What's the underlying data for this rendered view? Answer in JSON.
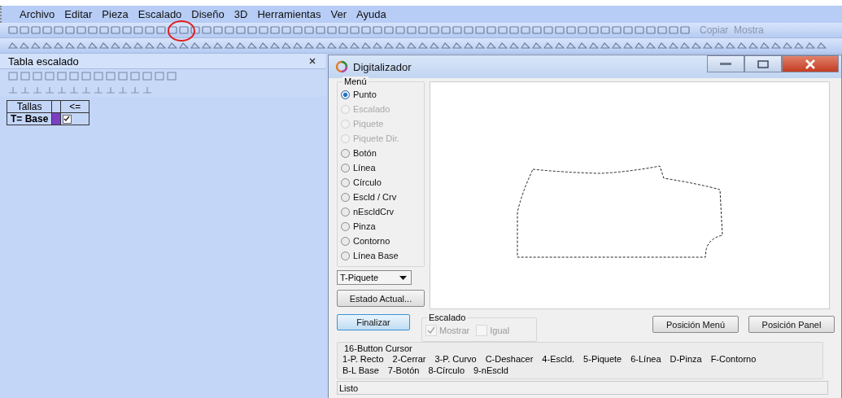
{
  "menu_bar": [
    "Archivo",
    "Editar",
    "Pieza",
    "Escalado",
    "Diseño",
    "3D",
    "Herramientas",
    "Ver",
    "Ayuda"
  ],
  "toolbar": {
    "text_button": "Copiar  Mostra"
  },
  "panel": {
    "title": "Tabla escalado",
    "columns": [
      "Tallas",
      "<="
    ],
    "rows": [
      {
        "label": "T= Base",
        "color": "#7b3fc4",
        "checked": true
      }
    ]
  },
  "dialog": {
    "title": "Digitalizador",
    "menu_label": "Menú",
    "options": [
      {
        "label": "Punto",
        "selected": true,
        "disabled": false
      },
      {
        "label": "Escalado",
        "selected": false,
        "disabled": true
      },
      {
        "label": "Piquete",
        "selected": false,
        "disabled": true
      },
      {
        "label": "Piquete Dir.",
        "selected": false,
        "disabled": true
      },
      {
        "label": "Botón",
        "selected": false,
        "disabled": false
      },
      {
        "label": "Línea",
        "selected": false,
        "disabled": false
      },
      {
        "label": "Círculo",
        "selected": false,
        "disabled": false
      },
      {
        "label": "Escld / Crv",
        "selected": false,
        "disabled": false
      },
      {
        "label": "nEscldCrv",
        "selected": false,
        "disabled": false
      },
      {
        "label": "Pinza",
        "selected": false,
        "disabled": false
      },
      {
        "label": "Contorno",
        "selected": false,
        "disabled": false
      },
      {
        "label": "Línea Base",
        "selected": false,
        "disabled": false
      }
    ],
    "dropdown": "T-Piquete",
    "state_button": "Estado Actual...",
    "finish_button": "Finalizar",
    "escalado": {
      "label": "Escalado",
      "checks": [
        {
          "label": "Mostrar",
          "checked": true,
          "disabled": true
        },
        {
          "label": "Igual",
          "checked": false,
          "disabled": true
        }
      ]
    },
    "position_buttons": [
      "Posición Menú",
      "Posición Panel"
    ],
    "cursor": {
      "label": "16-Button Cursor",
      "rows": [
        [
          "1-P. Recto",
          "2-Cerrar",
          "3-P. Curvo",
          "C-Deshacer",
          "4-Escld.",
          "5-Piquete",
          "6-Línea",
          "D-Pinza",
          "F-Contorno"
        ],
        [
          "B-L Base",
          "7-Botón",
          "8-Círculo",
          "9-nEscld"
        ]
      ]
    },
    "status": "Listo"
  }
}
